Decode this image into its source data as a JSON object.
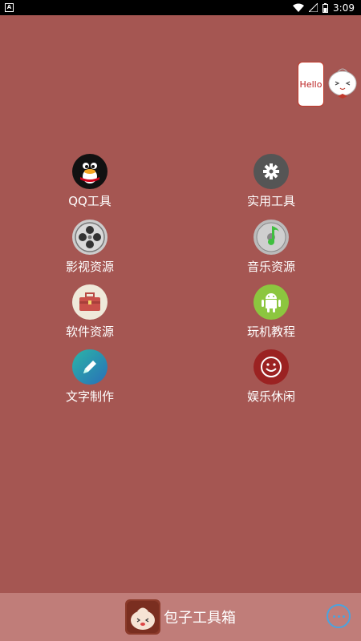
{
  "statusbar": {
    "time": "3:09"
  },
  "bubble": {
    "text": "Hello"
  },
  "tiles": [
    {
      "label": "QQ工具",
      "icon": "qq-penguin-icon"
    },
    {
      "label": "实用工具",
      "icon": "gear-icon"
    },
    {
      "label": "影视资源",
      "icon": "film-reel-icon"
    },
    {
      "label": "音乐资源",
      "icon": "music-disc-icon"
    },
    {
      "label": "软件资源",
      "icon": "toolbox-icon"
    },
    {
      "label": "玩机教程",
      "icon": "android-icon"
    },
    {
      "label": "文字制作",
      "icon": "pencil-icon"
    },
    {
      "label": "娱乐休闲",
      "icon": "smiley-icon"
    }
  ],
  "bottombar": {
    "app_name": "包子工具箱"
  },
  "colors": {
    "background": "#a55652",
    "bottombar": "#c07d79",
    "accent": "#4aa3df"
  }
}
